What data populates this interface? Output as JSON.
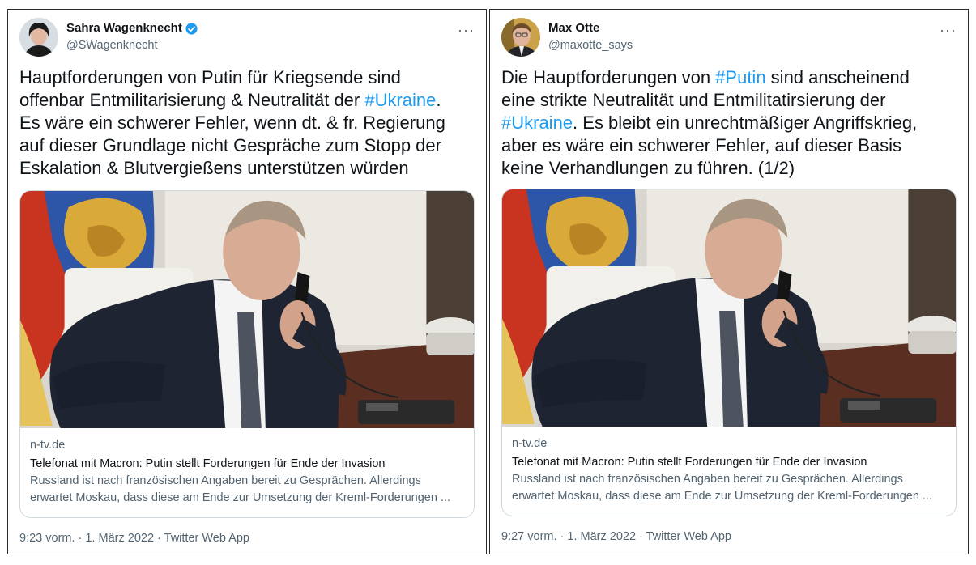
{
  "tweets": [
    {
      "author_name": "Sahra Wagenknecht",
      "handle": "@SWagenknecht",
      "verified": true,
      "more_label": "···",
      "text_parts": [
        "Hauptforderungen von Putin für Kriegsende sind\noffenbar Entmilitarisierung & Neutralität der ",
        "#Ukraine",
        ".\nEs wäre ein schwerer Fehler, wenn dt. & fr. Regierung\nauf dieser Grundlage nicht Gespräche zum Stopp der\nEskalation & Blutvergießens unterstützen würden"
      ],
      "card": {
        "domain": "n-tv.de",
        "title": "Telefonat mit Macron: Putin stellt Forderungen für Ende der Invasion",
        "description_line1": "Russland ist nach französischen Angaben bereit zu Gesprächen. Allerdings",
        "description_line2": "erwartet Moskau, dass diese am Ende zur Umsetzung der Kreml-Forderungen ..."
      },
      "footer": "9:23 vorm. · 1. März 2022 · Twitter Web App"
    },
    {
      "author_name": "Max Otte",
      "handle": "@maxotte_says",
      "verified": false,
      "more_label": "···",
      "text_parts": [
        "Die Hauptforderungen von ",
        "#Putin",
        " sind anscheinend\neine strikte Neutralität und Entmilitatirsierung der\n",
        "#Ukraine",
        ". Es bleibt ein unrechtmäßiger Angriffskrieg,\naber es wäre ein schwerer Fehler, auf dieser Basis\nkeine Verhandlungen zu führen. (1/2)"
      ],
      "card": {
        "domain": "n-tv.de",
        "title": "Telefonat mit Macron: Putin stellt Forderungen für Ende der Invasion",
        "description_line1": "Russland ist nach französischen Angaben bereit zu Gesprächen. Allerdings",
        "description_line2": "erwartet Moskau, dass diese am Ende zur Umsetzung der Kreml-Forderungen ..."
      },
      "footer": "9:27 vorm. · 1. März 2022 · Twitter Web App"
    }
  ],
  "colors": {
    "hashtag": "#1d9bf0",
    "verified_badge": "#1d9bf0",
    "secondary_text": "#536471"
  }
}
